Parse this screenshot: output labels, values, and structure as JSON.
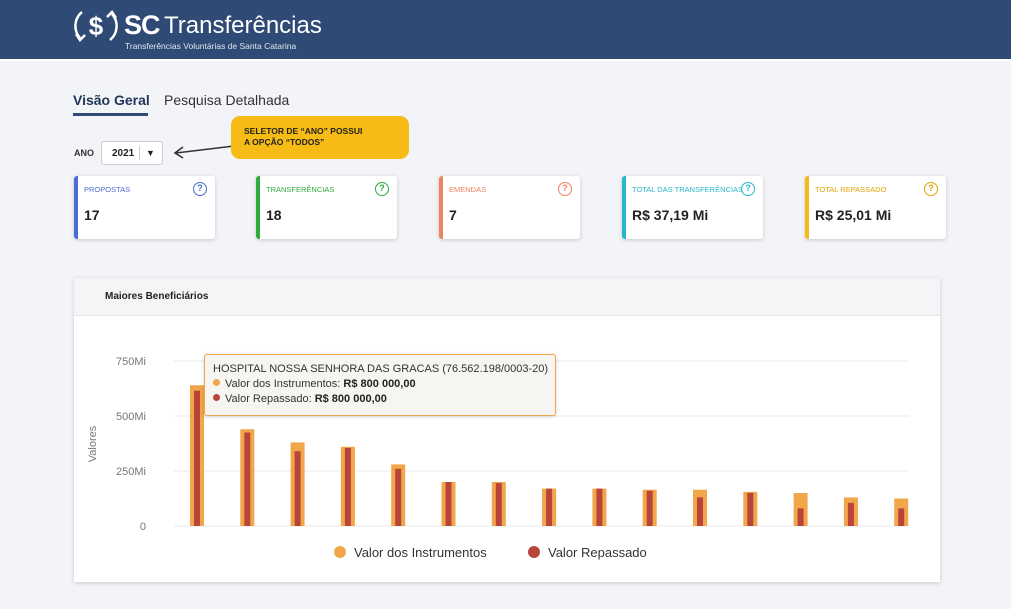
{
  "header": {
    "logo_sc": "SC",
    "logo_name": "Transferências",
    "logo_subtitle": "Transferências Voluntárias de Santa Catarina",
    "logo_icon": "dollar-arrows-icon",
    "bg_color": "#2f4a74"
  },
  "tabs": [
    {
      "label": "Visão Geral",
      "active": true
    },
    {
      "label": "Pesquisa Detalhada",
      "active": false
    }
  ],
  "filter": {
    "label": "ANO",
    "value": "2021",
    "caret": "▼"
  },
  "callout": {
    "line1": "SELETOR DE “ANO” POSSUI",
    "line2": "A OPÇÃO “TODOS”",
    "color": "#f6bb14"
  },
  "cards": [
    {
      "title": "PROPOSTAS",
      "value": "17",
      "color": "#4a6cd4"
    },
    {
      "title": "TRANSFERÊNCIAS",
      "value": "18",
      "color": "#2faa3f"
    },
    {
      "title": "EMENDAS",
      "value": "7",
      "color": "#f0825f"
    },
    {
      "title": "TOTAL DAS TRANSFERÊNCIAS",
      "value": "R$ 37,19 Mi",
      "color": "#2ab7c9"
    },
    {
      "title": "TOTAL REPASSADO",
      "value": "R$ 25,01 Mi",
      "color": "#f5b91a"
    }
  ],
  "help_icon": "?",
  "chart_panel": {
    "title": "Maiores Beneficiários"
  },
  "chart_data": {
    "type": "bar",
    "ylabel": "Valores",
    "y_ticks": [
      "0",
      "250Mi",
      "500Mi",
      "750Mi"
    ],
    "ylim": [
      0,
      750
    ],
    "grid": true,
    "legend_position": "bottom",
    "series": [
      {
        "name": "Valor dos Instrumentos",
        "color": "#f2a64a",
        "values": [
          640,
          440,
          380,
          360,
          280,
          200,
          200,
          170,
          170,
          165,
          165,
          155,
          150,
          130,
          125
        ]
      },
      {
        "name": "Valor Repassado",
        "color": "#b8443a",
        "values": [
          615,
          425,
          340,
          355,
          260,
          200,
          195,
          170,
          170,
          160,
          130,
          150,
          80,
          105,
          80
        ]
      }
    ]
  },
  "tooltip": {
    "title": "HOSPITAL NOSSA SENHORA DAS GRACAS (76.562.198/0003-20)",
    "row1_label": "Valor dos Instrumentos:",
    "row1_value": "R$ 800 000,00",
    "row2_label": "Valor Repassado:",
    "row2_value": "R$ 800 000,00"
  }
}
